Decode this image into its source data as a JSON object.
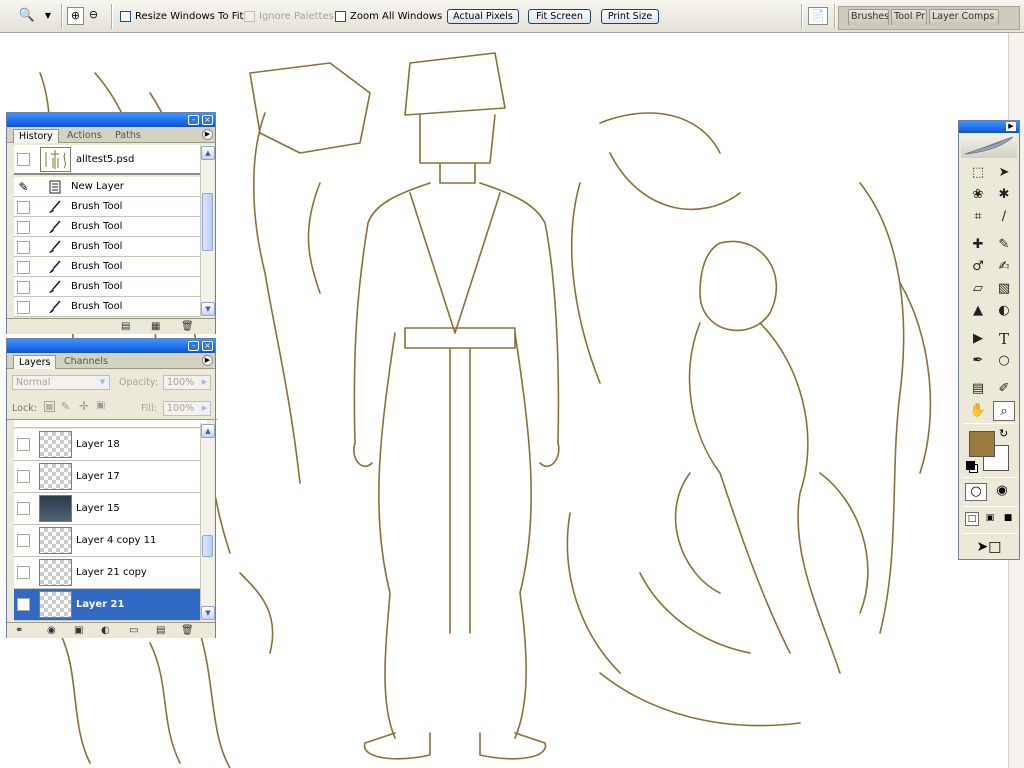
{
  "colors": {
    "sketch": "#8b7035",
    "foreground": "#9a7b3e",
    "background": "#ffffff",
    "selected_row": "#316ac5",
    "palette_title": "#0a55d6"
  },
  "options_bar": {
    "icons": [
      "zoom-tool-icon",
      "dropdown-arrow-icon",
      "zoom-in-icon",
      "zoom-out-icon"
    ],
    "checkboxes": [
      {
        "label": "Resize Windows To Fit",
        "checked": false,
        "enabled": true
      },
      {
        "label": "Ignore Palettes",
        "checked": false,
        "enabled": false
      },
      {
        "label": "Zoom All Windows",
        "checked": false,
        "enabled": true
      }
    ],
    "buttons": [
      "Actual Pixels",
      "Fit Screen",
      "Print Size"
    ],
    "file_browser_icon": "file-browser-icon",
    "well_tabs": [
      "Brushes",
      "Tool Pr",
      "Layer Comps"
    ]
  },
  "history": {
    "tabs": [
      "History",
      "Actions",
      "Paths"
    ],
    "active_tab": "History",
    "snapshot": "alltest5.psd",
    "items": [
      {
        "label": "New Layer",
        "icon": "new-layer-icon"
      },
      {
        "label": "Brush Tool",
        "icon": "brush-icon"
      },
      {
        "label": "Brush Tool",
        "icon": "brush-icon"
      },
      {
        "label": "Brush Tool",
        "icon": "brush-icon"
      },
      {
        "label": "Brush Tool",
        "icon": "brush-icon"
      },
      {
        "label": "Brush Tool",
        "icon": "brush-icon"
      },
      {
        "label": "Brush Tool",
        "icon": "brush-icon"
      }
    ]
  },
  "layers": {
    "tabs": [
      "Layers",
      "Channels"
    ],
    "active_tab": "Layers",
    "blend_mode": "Normal",
    "opacity_label": "Opacity:",
    "opacity": "100%",
    "lock_label": "Lock:",
    "fill_label": "Fill:",
    "fill": "100%",
    "items": [
      {
        "name": "Layer 18",
        "thumb": "transparent"
      },
      {
        "name": "Layer 17",
        "thumb": "transparent"
      },
      {
        "name": "Layer 15",
        "thumb": "image"
      },
      {
        "name": "Layer 4 copy 11",
        "thumb": "transparent"
      },
      {
        "name": "Layer 21 copy",
        "thumb": "transparent"
      },
      {
        "name": "Layer 21",
        "thumb": "transparent",
        "selected": true
      }
    ]
  },
  "toolbox": {
    "tools": [
      "marquee",
      "move",
      "lasso",
      "magic-wand",
      "crop",
      "slice",
      "healing-brush",
      "brush",
      "clone-stamp",
      "history-brush",
      "eraser",
      "gradient",
      "blur",
      "dodge",
      "path-selection",
      "type",
      "pen",
      "shape",
      "notes",
      "eyedropper",
      "hand",
      "zoom"
    ],
    "active_tool": "zoom",
    "type_tool_glyph": "T"
  }
}
